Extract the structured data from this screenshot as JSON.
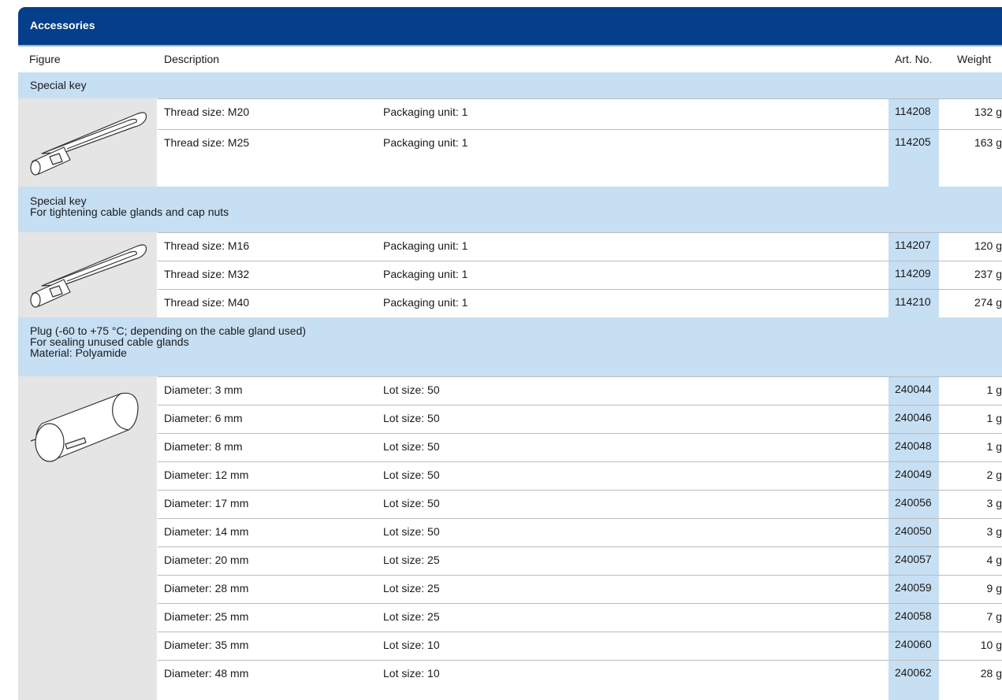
{
  "title": "Accessories",
  "columns": {
    "figure": "Figure",
    "description": "Description",
    "art_no": "Art. No.",
    "weight": "Weight"
  },
  "sections": [
    {
      "lines": [
        "Special key"
      ],
      "rows": [
        {
          "description": "Thread size: M20",
          "pack": "Packaging unit: 1",
          "art_no": "114208",
          "weight": "132 g"
        },
        {
          "description": "Thread size: M25",
          "pack": "Packaging unit: 1",
          "art_no": "114205",
          "weight": "163 g"
        }
      ]
    },
    {
      "lines": [
        "Special key",
        "For tightening cable glands and cap nuts"
      ],
      "rows": [
        {
          "description": "Thread size: M16",
          "pack": "Packaging unit: 1",
          "art_no": "114207",
          "weight": "120 g"
        },
        {
          "description": "Thread size: M32",
          "pack": "Packaging unit: 1",
          "art_no": "114209",
          "weight": "237 g"
        },
        {
          "description": "Thread size: M40",
          "pack": "Packaging unit: 1",
          "art_no": "114210",
          "weight": "274 g"
        }
      ]
    },
    {
      "lines": [
        "Plug (-60 to +75 °C; depending on the cable gland used)",
        "For sealing unused cable glands",
        "Material: Polyamide"
      ],
      "rows": [
        {
          "description": "Diameter: 3 mm",
          "pack": "Lot size: 50",
          "art_no": "240044",
          "weight": "1 g"
        },
        {
          "description": "Diameter: 6 mm",
          "pack": "Lot size: 50",
          "art_no": "240046",
          "weight": "1 g"
        },
        {
          "description": "Diameter: 8 mm",
          "pack": "Lot size: 50",
          "art_no": "240048",
          "weight": "1 g"
        },
        {
          "description": "Diameter: 12 mm",
          "pack": "Lot size: 50",
          "art_no": "240049",
          "weight": "2 g"
        },
        {
          "description": "Diameter: 17 mm",
          "pack": "Lot size: 50",
          "art_no": "240056",
          "weight": "3 g"
        },
        {
          "description": "Diameter: 14 mm",
          "pack": "Lot size: 50",
          "art_no": "240050",
          "weight": "3 g"
        },
        {
          "description": "Diameter: 20 mm",
          "pack": "Lot size: 25",
          "art_no": "240057",
          "weight": "4 g"
        },
        {
          "description": "Diameter: 28 mm",
          "pack": "Lot size: 25",
          "art_no": "240059",
          "weight": "9 g"
        },
        {
          "description": "Diameter: 25 mm",
          "pack": "Lot size: 25",
          "art_no": "240058",
          "weight": "7 g"
        },
        {
          "description": "Diameter: 35 mm",
          "pack": "Lot size: 10",
          "art_no": "240060",
          "weight": "10 g"
        },
        {
          "description": "Diameter: 48 mm",
          "pack": "Lot size: 10",
          "art_no": "240062",
          "weight": "28 g"
        }
      ]
    }
  ],
  "colors": {
    "title_bar": "#053e8a",
    "section_band": "#c7dff3",
    "figure_bg": "#e5e5e5"
  }
}
